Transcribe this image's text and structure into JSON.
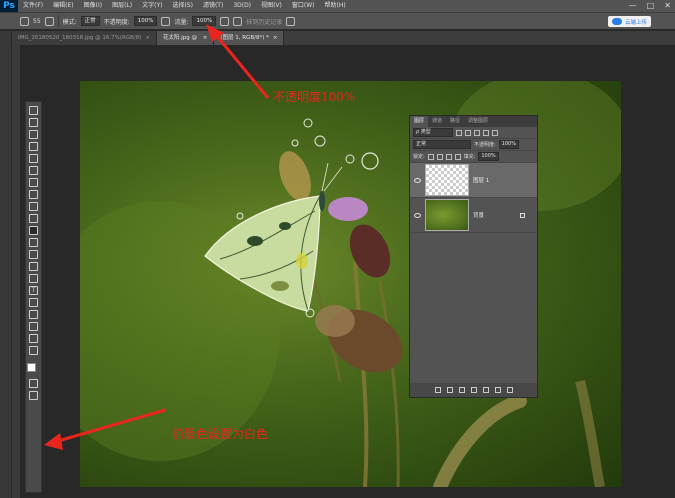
{
  "app": {
    "logo": "Ps"
  },
  "menu": [
    "文件(F)",
    "编辑(E)",
    "图像(I)",
    "图层(L)",
    "文字(Y)",
    "选择(S)",
    "滤镜(T)",
    "3D(D)",
    "视图(V)",
    "窗口(W)",
    "帮助(H)"
  ],
  "window_controls": {
    "min": "—",
    "max": "□",
    "close": "✕"
  },
  "options": {
    "brush_size": "55",
    "mode_label": "模式:",
    "mode_value": "正常",
    "opacity_label": "不透明度:",
    "opacity_value": "100%",
    "flow_label": "流量:",
    "flow_value": "100%",
    "erase_history": "抹到历史记录",
    "cloud_button": "云端上传"
  },
  "tabs": [
    {
      "label": "IMG_20180520_180318.jpg @ 16.7%(RGB/8)",
      "close": "×"
    },
    {
      "label": "花太阳.jpg @ ",
      "close": "×"
    },
    {
      "label": "(图层 1, RGB/8*) *",
      "close": "×"
    }
  ],
  "layers_panel": {
    "tabs": [
      "图层",
      "通道",
      "路径",
      "调整图层"
    ],
    "filter_kind": "ρ 类型",
    "blend_mode": "正常",
    "opacity_label": "不透明度:",
    "opacity_value": "100%",
    "lock_label": "锁定:",
    "fill_label": "填充:",
    "fill_value": "100%",
    "layers": [
      {
        "name": "图层 1"
      },
      {
        "name": "背景"
      }
    ]
  },
  "annotations": {
    "opacity_note": "不透明度100%",
    "foreground_note": "前景色设置为白色"
  },
  "colors": {
    "accent_red": "#e8261d",
    "foreground_color": "#ffffff",
    "background_color": "#000000"
  }
}
